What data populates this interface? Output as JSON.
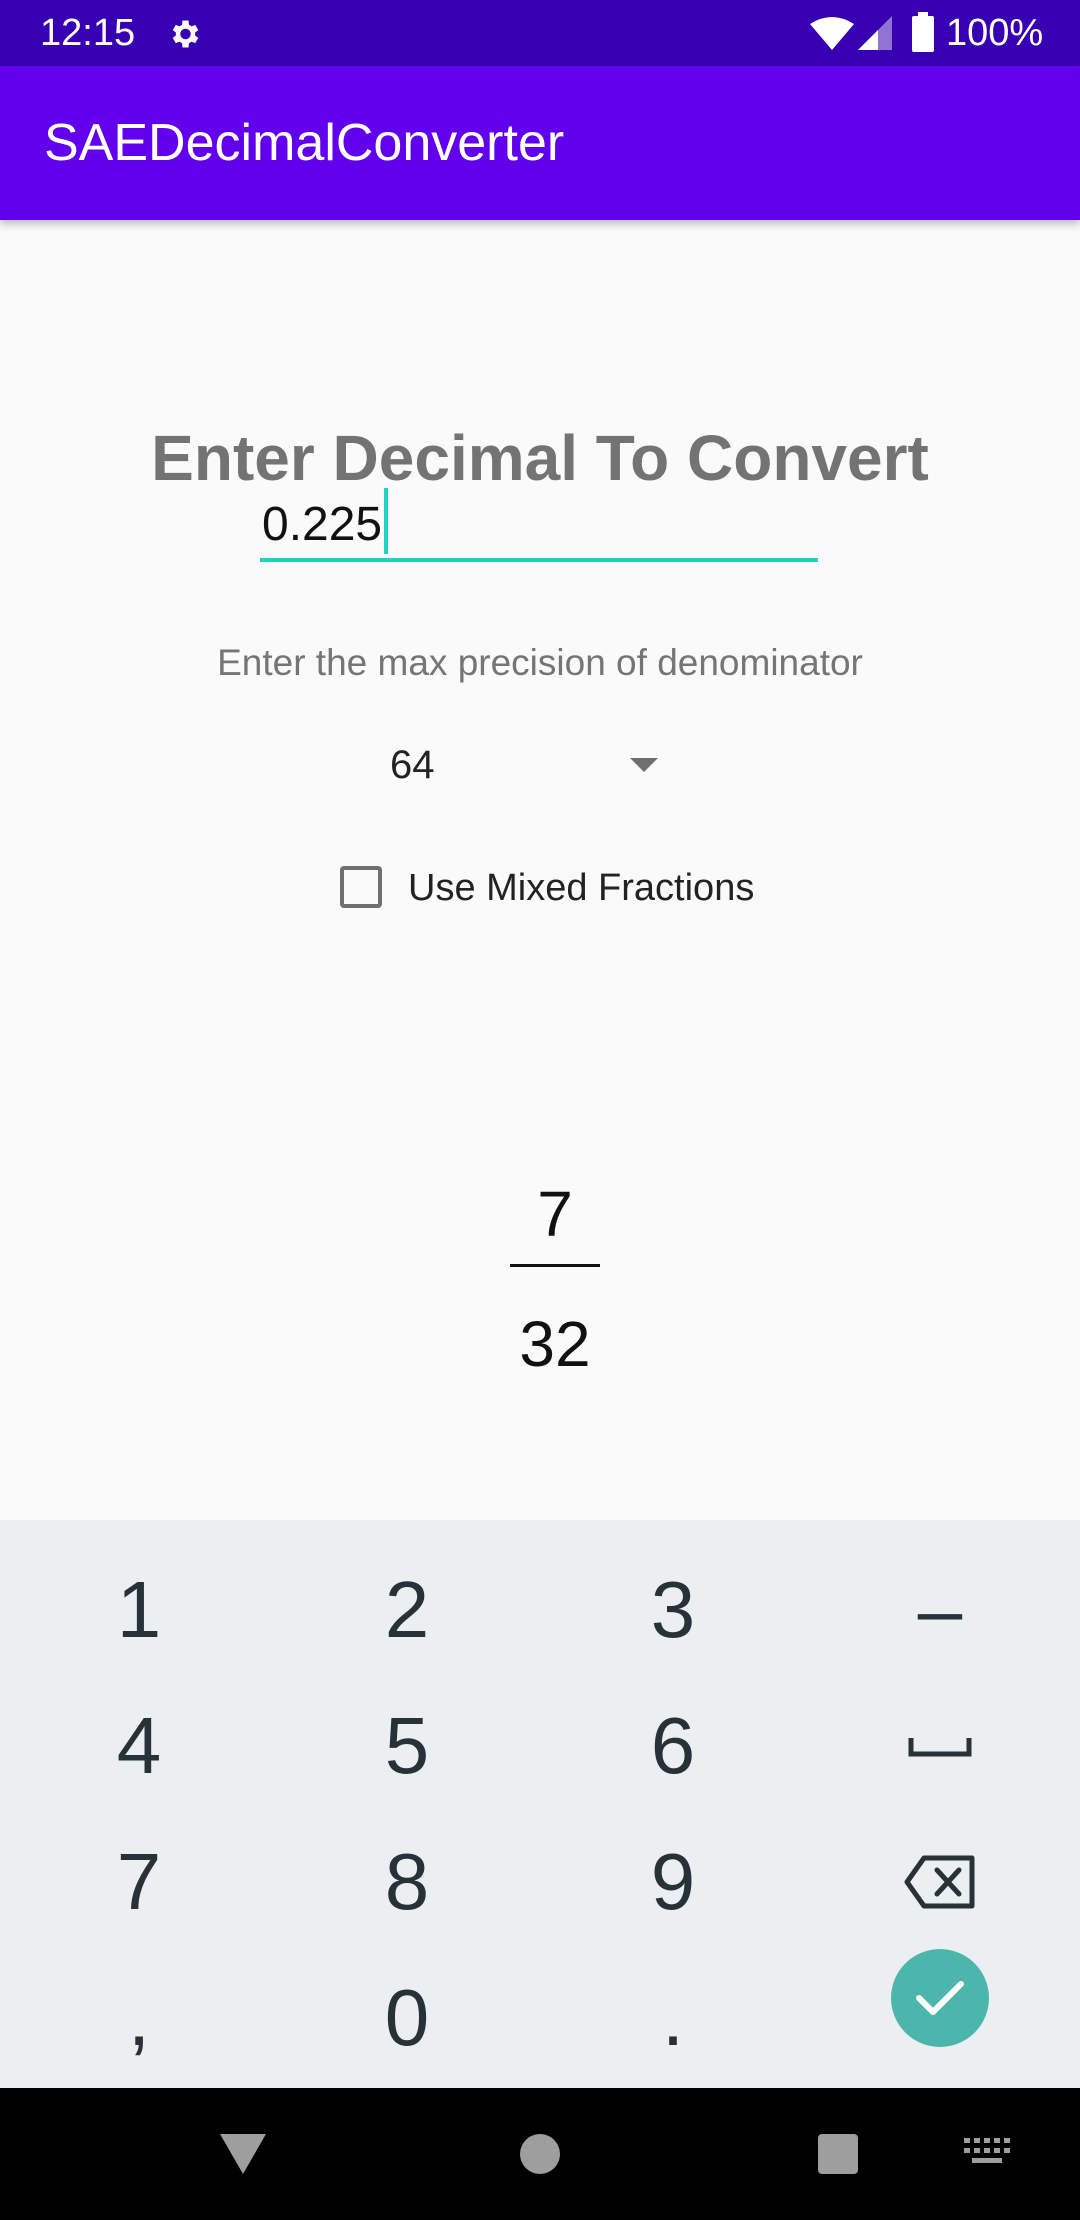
{
  "status_bar": {
    "time": "12:15",
    "battery": "100%",
    "icons": [
      "gear-icon",
      "wifi-icon",
      "signal-icon",
      "battery-icon"
    ]
  },
  "app_bar": {
    "title": "SAEDecimalConverter",
    "color": "#6200ee"
  },
  "main": {
    "heading": "Enter Decimal To Convert",
    "decimal_value": "0.225",
    "precision_label": "Enter the max precision of denominator",
    "precision_selected": "64",
    "mixed_fractions_label": "Use Mixed Fractions",
    "mixed_fractions_checked": false,
    "result": {
      "numerator": "7",
      "denominator": "32"
    },
    "accent_color": "#1dd3c2"
  },
  "keyboard": {
    "rows": [
      [
        "1",
        "2",
        "3",
        "–"
      ],
      [
        "4",
        "5",
        "6",
        "space-icon"
      ],
      [
        "7",
        "8",
        "9",
        "backspace-icon"
      ],
      [
        ",",
        "0",
        ".",
        "enter-check-icon"
      ]
    ]
  },
  "nav_bar": {
    "icons": [
      "back-icon",
      "home-icon",
      "recents-icon",
      "keyboard-switch-icon"
    ]
  }
}
